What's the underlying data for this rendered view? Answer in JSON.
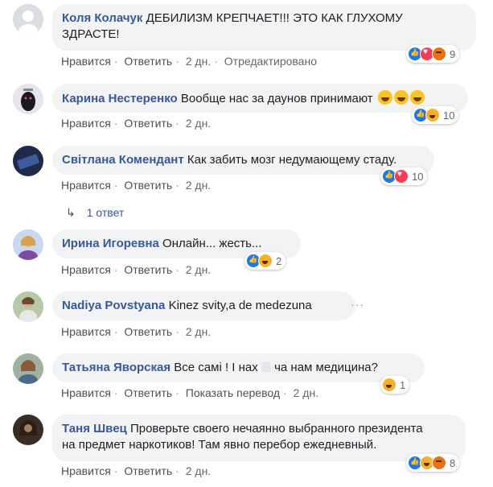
{
  "comments": [
    {
      "author": "Коля Колачук",
      "text_line1": "ДЕБИЛИЗМ КРЕПЧАЕТ!!! ЭТО КАК ГЛУХОМУ",
      "text_line2": "ЗДРАСТЕ!",
      "like": "Нравится",
      "reply": "Ответить",
      "time": "2 дн.",
      "edited": "Отредактировано",
      "reaction_count": "9"
    },
    {
      "author": "Карина Нестеренко",
      "text": "Вообще нас за даунов принимают",
      "like": "Нравится",
      "reply": "Ответить",
      "time": "2 дн.",
      "reaction_count": "10"
    },
    {
      "author": "Світлана Комендант",
      "text": "Как забить мозг недумающему стаду.",
      "like": "Нравится",
      "reply": "Ответить",
      "time": "2 дн.",
      "reaction_count": "10"
    },
    {
      "author": "Ирина Игоревна",
      "text": "Онлайн... жесть...",
      "like": "Нравится",
      "reply": "Ответить",
      "time": "2 дн.",
      "reaction_count": "2"
    },
    {
      "author": "Nadiya Povstyana",
      "text": "Kinez svity,a de medezuna",
      "like": "Нравится",
      "reply": "Ответить",
      "time": "2 дн."
    },
    {
      "author": "Татьяна Яворская",
      "text": "Все самі ! І нах",
      "text_after": "ча нам медицина?",
      "like": "Нравится",
      "reply": "Ответить",
      "translate": "Показать перевод",
      "time": "2 дн.",
      "reaction_count": "1"
    },
    {
      "author": "Таня Швец",
      "text_line1": "Проверьте своего нечаянно выбранного президента",
      "text_line2": "на предмет наркотиков! Там явно перебор ежедневный.",
      "like": "Нравится",
      "reply": "Ответить",
      "time": "2 дн.",
      "reaction_count": "8"
    }
  ],
  "replies_link": "1 ответ",
  "more_options": "···",
  "colors": {
    "author": "#385898",
    "bubble": "#f2f3f5",
    "meta": "#606770"
  },
  "icons": {
    "reply_arrow": "reply-arrow-icon",
    "like": "like-reaction-icon",
    "love": "love-reaction-icon",
    "haha": "haha-reaction-icon",
    "angry": "angry-reaction-icon"
  }
}
